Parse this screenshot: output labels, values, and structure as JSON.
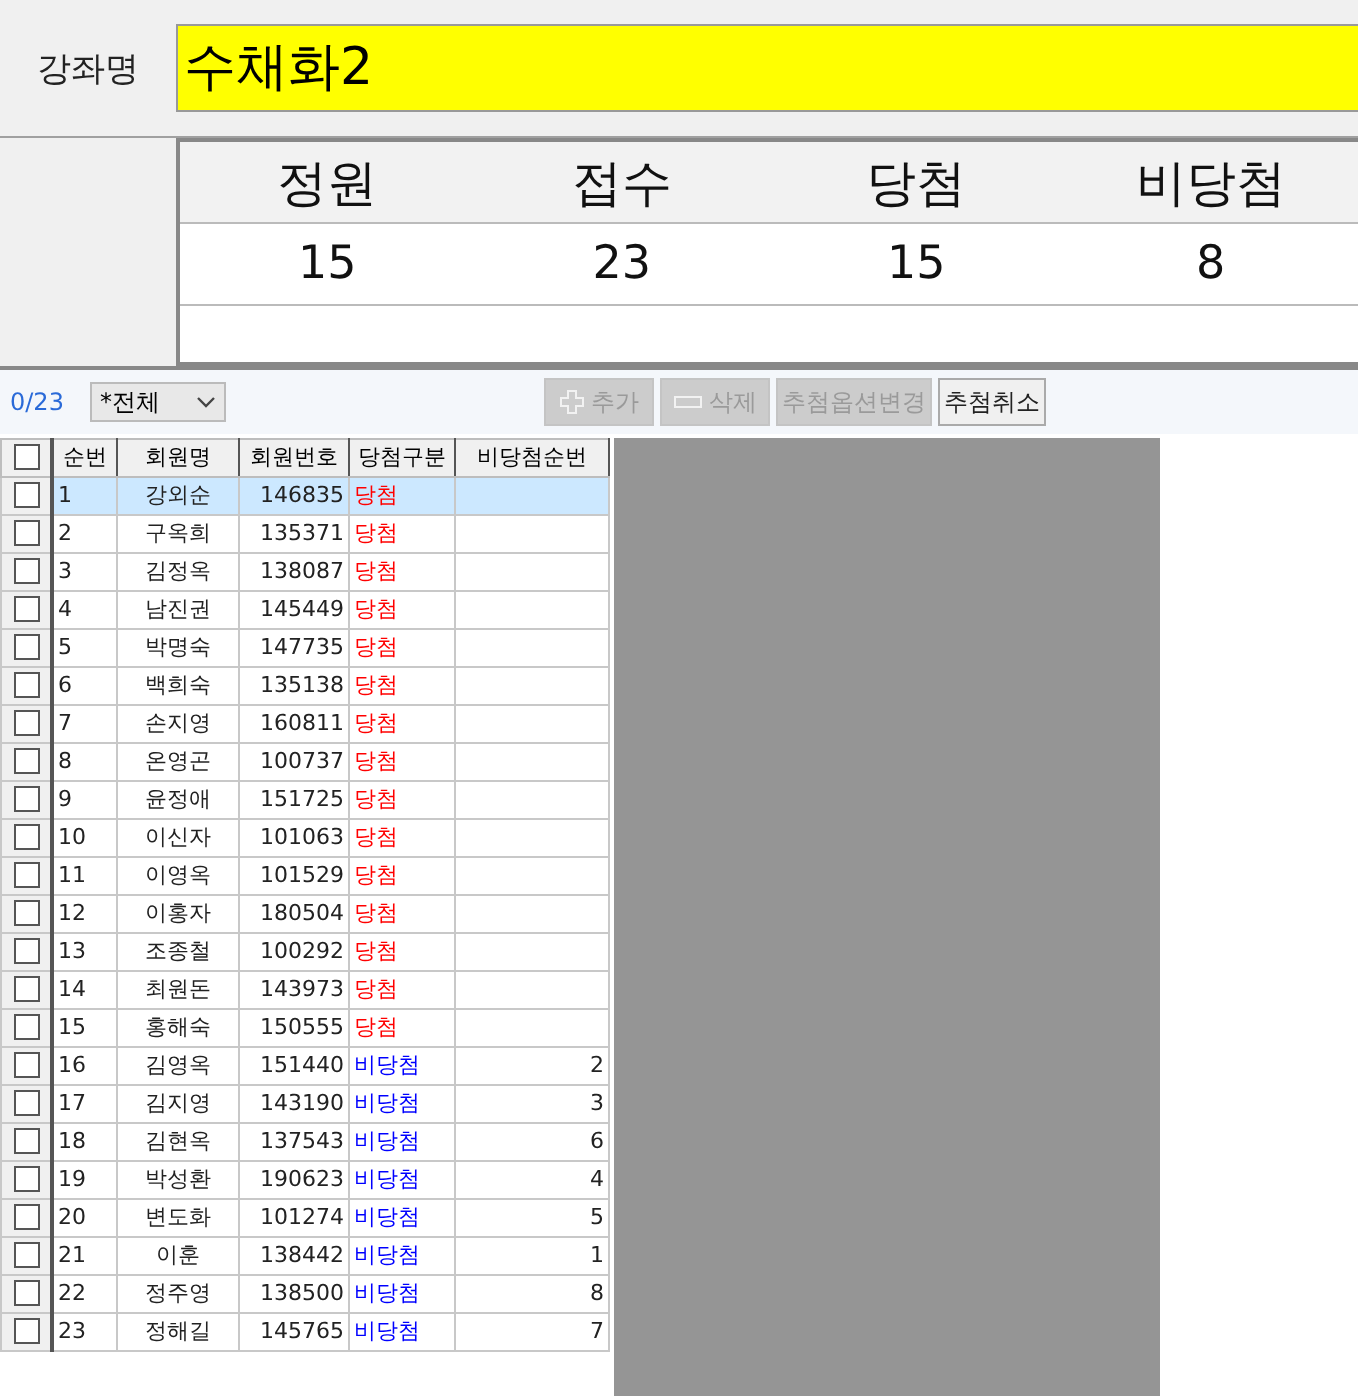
{
  "course": {
    "label": "강좌명",
    "value": "수채화2"
  },
  "summary": {
    "columns": [
      "정원",
      "접수",
      "당첨",
      "비당첨"
    ],
    "values": [
      "15",
      "23",
      "15",
      "8"
    ]
  },
  "toolbar": {
    "count": "0/23",
    "filter": "*전체",
    "buttons": [
      {
        "label": "추가",
        "kind": "add",
        "disabled": true
      },
      {
        "label": "삭제",
        "kind": "delete",
        "disabled": true
      },
      {
        "label": "추첨옵션변경",
        "kind": "plain",
        "disabled": true
      },
      {
        "label": "추첨취소",
        "kind": "plain",
        "disabled": false
      }
    ]
  },
  "table": {
    "header_checked": false,
    "columns": [
      "순번",
      "회원명",
      "회원번호",
      "당첨구분",
      "비당첨순번"
    ],
    "rows": [
      {
        "cells": [
          "1",
          "강외순",
          "146835",
          "당첨",
          ""
        ],
        "checked": false,
        "selected": true,
        "color": "#ff0000"
      },
      {
        "cells": [
          "2",
          "구옥희",
          "135371",
          "당첨",
          ""
        ],
        "checked": false,
        "selected": false,
        "color": "#ff0000"
      },
      {
        "cells": [
          "3",
          "김정옥",
          "138087",
          "당첨",
          ""
        ],
        "checked": false,
        "selected": false,
        "color": "#ff0000"
      },
      {
        "cells": [
          "4",
          "남진권",
          "145449",
          "당첨",
          ""
        ],
        "checked": false,
        "selected": false,
        "color": "#ff0000"
      },
      {
        "cells": [
          "5",
          "박명숙",
          "147735",
          "당첨",
          ""
        ],
        "checked": false,
        "selected": false,
        "color": "#ff0000"
      },
      {
        "cells": [
          "6",
          "백희숙",
          "135138",
          "당첨",
          ""
        ],
        "checked": false,
        "selected": false,
        "color": "#ff0000"
      },
      {
        "cells": [
          "7",
          "손지영",
          "160811",
          "당첨",
          ""
        ],
        "checked": false,
        "selected": false,
        "color": "#ff0000"
      },
      {
        "cells": [
          "8",
          "온영곤",
          "100737",
          "당첨",
          ""
        ],
        "checked": false,
        "selected": false,
        "color": "#ff0000"
      },
      {
        "cells": [
          "9",
          "윤정애",
          "151725",
          "당첨",
          ""
        ],
        "checked": false,
        "selected": false,
        "color": "#ff0000"
      },
      {
        "cells": [
          "10",
          "이신자",
          "101063",
          "당첨",
          ""
        ],
        "checked": false,
        "selected": false,
        "color": "#ff0000"
      },
      {
        "cells": [
          "11",
          "이영옥",
          "101529",
          "당첨",
          ""
        ],
        "checked": false,
        "selected": false,
        "color": "#ff0000"
      },
      {
        "cells": [
          "12",
          "이홍자",
          "180504",
          "당첨",
          ""
        ],
        "checked": false,
        "selected": false,
        "color": "#ff0000"
      },
      {
        "cells": [
          "13",
          "조종철",
          "100292",
          "당첨",
          ""
        ],
        "checked": false,
        "selected": false,
        "color": "#ff0000"
      },
      {
        "cells": [
          "14",
          "최원돈",
          "143973",
          "당첨",
          ""
        ],
        "checked": false,
        "selected": false,
        "color": "#ff0000"
      },
      {
        "cells": [
          "15",
          "홍해숙",
          "150555",
          "당첨",
          ""
        ],
        "checked": false,
        "selected": false,
        "color": "#ff0000"
      },
      {
        "cells": [
          "16",
          "김영옥",
          "151440",
          "비당첨",
          "2"
        ],
        "checked": false,
        "selected": false,
        "color": "#0000ff"
      },
      {
        "cells": [
          "17",
          "김지영",
          "143190",
          "비당첨",
          "3"
        ],
        "checked": false,
        "selected": false,
        "color": "#0000ff"
      },
      {
        "cells": [
          "18",
          "김현옥",
          "137543",
          "비당첨",
          "6"
        ],
        "checked": false,
        "selected": false,
        "color": "#0000ff"
      },
      {
        "cells": [
          "19",
          "박성환",
          "190623",
          "비당첨",
          "4"
        ],
        "checked": false,
        "selected": false,
        "color": "#0000ff"
      },
      {
        "cells": [
          "20",
          "변도화",
          "101274",
          "비당첨",
          "5"
        ],
        "checked": false,
        "selected": false,
        "color": "#0000ff"
      },
      {
        "cells": [
          "21",
          "이훈",
          "138442",
          "비당첨",
          "1"
        ],
        "checked": false,
        "selected": false,
        "color": "#0000ff"
      },
      {
        "cells": [
          "22",
          "정주영",
          "138500",
          "비당첨",
          "8"
        ],
        "checked": false,
        "selected": false,
        "color": "#0000ff"
      },
      {
        "cells": [
          "23",
          "정해길",
          "145765",
          "비당첨",
          "7"
        ],
        "checked": false,
        "selected": false,
        "color": "#0000ff"
      }
    ]
  }
}
